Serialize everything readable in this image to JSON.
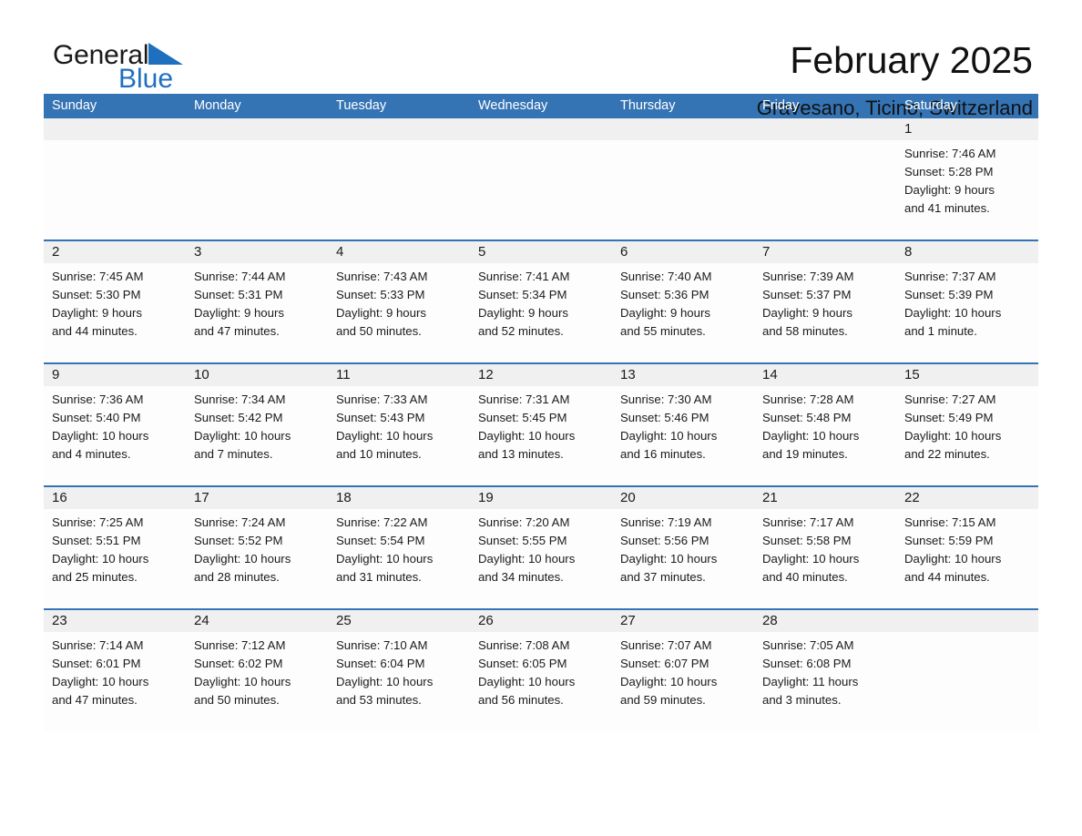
{
  "brand": {
    "name_part1": "General",
    "name_part2": "Blue",
    "logo_icon": "triangle-mark",
    "colors": {
      "text": "#1a1a1a",
      "accent": "#1f6fbf"
    }
  },
  "header": {
    "title": "February 2025",
    "subtitle": "Gravesano, Ticino, Switzerland"
  },
  "theme": {
    "header_blue": "#3574b4",
    "daynum_strip": "#f0f0f0",
    "cell_background": "#fdfdfd",
    "text": "#1a1a1a"
  },
  "weekdays": [
    "Sunday",
    "Monday",
    "Tuesday",
    "Wednesday",
    "Thursday",
    "Friday",
    "Saturday"
  ],
  "weeks": [
    {
      "days": [
        {
          "date": "",
          "sunrise": "",
          "sunset": "",
          "daylight_line1": "",
          "daylight_line2": "",
          "empty": true
        },
        {
          "date": "",
          "sunrise": "",
          "sunset": "",
          "daylight_line1": "",
          "daylight_line2": "",
          "empty": true
        },
        {
          "date": "",
          "sunrise": "",
          "sunset": "",
          "daylight_line1": "",
          "daylight_line2": "",
          "empty": true
        },
        {
          "date": "",
          "sunrise": "",
          "sunset": "",
          "daylight_line1": "",
          "daylight_line2": "",
          "empty": true
        },
        {
          "date": "",
          "sunrise": "",
          "sunset": "",
          "daylight_line1": "",
          "daylight_line2": "",
          "empty": true
        },
        {
          "date": "",
          "sunrise": "",
          "sunset": "",
          "daylight_line1": "",
          "daylight_line2": "",
          "empty": true
        },
        {
          "date": "1",
          "sunrise": "Sunrise: 7:46 AM",
          "sunset": "Sunset: 5:28 PM",
          "daylight_line1": "Daylight: 9 hours",
          "daylight_line2": "and 41 minutes.",
          "empty": false
        }
      ]
    },
    {
      "days": [
        {
          "date": "2",
          "sunrise": "Sunrise: 7:45 AM",
          "sunset": "Sunset: 5:30 PM",
          "daylight_line1": "Daylight: 9 hours",
          "daylight_line2": "and 44 minutes.",
          "empty": false
        },
        {
          "date": "3",
          "sunrise": "Sunrise: 7:44 AM",
          "sunset": "Sunset: 5:31 PM",
          "daylight_line1": "Daylight: 9 hours",
          "daylight_line2": "and 47 minutes.",
          "empty": false
        },
        {
          "date": "4",
          "sunrise": "Sunrise: 7:43 AM",
          "sunset": "Sunset: 5:33 PM",
          "daylight_line1": "Daylight: 9 hours",
          "daylight_line2": "and 50 minutes.",
          "empty": false
        },
        {
          "date": "5",
          "sunrise": "Sunrise: 7:41 AM",
          "sunset": "Sunset: 5:34 PM",
          "daylight_line1": "Daylight: 9 hours",
          "daylight_line2": "and 52 minutes.",
          "empty": false
        },
        {
          "date": "6",
          "sunrise": "Sunrise: 7:40 AM",
          "sunset": "Sunset: 5:36 PM",
          "daylight_line1": "Daylight: 9 hours",
          "daylight_line2": "and 55 minutes.",
          "empty": false
        },
        {
          "date": "7",
          "sunrise": "Sunrise: 7:39 AM",
          "sunset": "Sunset: 5:37 PM",
          "daylight_line1": "Daylight: 9 hours",
          "daylight_line2": "and 58 minutes.",
          "empty": false
        },
        {
          "date": "8",
          "sunrise": "Sunrise: 7:37 AM",
          "sunset": "Sunset: 5:39 PM",
          "daylight_line1": "Daylight: 10 hours",
          "daylight_line2": "and 1 minute.",
          "empty": false
        }
      ]
    },
    {
      "days": [
        {
          "date": "9",
          "sunrise": "Sunrise: 7:36 AM",
          "sunset": "Sunset: 5:40 PM",
          "daylight_line1": "Daylight: 10 hours",
          "daylight_line2": "and 4 minutes.",
          "empty": false
        },
        {
          "date": "10",
          "sunrise": "Sunrise: 7:34 AM",
          "sunset": "Sunset: 5:42 PM",
          "daylight_line1": "Daylight: 10 hours",
          "daylight_line2": "and 7 minutes.",
          "empty": false
        },
        {
          "date": "11",
          "sunrise": "Sunrise: 7:33 AM",
          "sunset": "Sunset: 5:43 PM",
          "daylight_line1": "Daylight: 10 hours",
          "daylight_line2": "and 10 minutes.",
          "empty": false
        },
        {
          "date": "12",
          "sunrise": "Sunrise: 7:31 AM",
          "sunset": "Sunset: 5:45 PM",
          "daylight_line1": "Daylight: 10 hours",
          "daylight_line2": "and 13 minutes.",
          "empty": false
        },
        {
          "date": "13",
          "sunrise": "Sunrise: 7:30 AM",
          "sunset": "Sunset: 5:46 PM",
          "daylight_line1": "Daylight: 10 hours",
          "daylight_line2": "and 16 minutes.",
          "empty": false
        },
        {
          "date": "14",
          "sunrise": "Sunrise: 7:28 AM",
          "sunset": "Sunset: 5:48 PM",
          "daylight_line1": "Daylight: 10 hours",
          "daylight_line2": "and 19 minutes.",
          "empty": false
        },
        {
          "date": "15",
          "sunrise": "Sunrise: 7:27 AM",
          "sunset": "Sunset: 5:49 PM",
          "daylight_line1": "Daylight: 10 hours",
          "daylight_line2": "and 22 minutes.",
          "empty": false
        }
      ]
    },
    {
      "days": [
        {
          "date": "16",
          "sunrise": "Sunrise: 7:25 AM",
          "sunset": "Sunset: 5:51 PM",
          "daylight_line1": "Daylight: 10 hours",
          "daylight_line2": "and 25 minutes.",
          "empty": false
        },
        {
          "date": "17",
          "sunrise": "Sunrise: 7:24 AM",
          "sunset": "Sunset: 5:52 PM",
          "daylight_line1": "Daylight: 10 hours",
          "daylight_line2": "and 28 minutes.",
          "empty": false
        },
        {
          "date": "18",
          "sunrise": "Sunrise: 7:22 AM",
          "sunset": "Sunset: 5:54 PM",
          "daylight_line1": "Daylight: 10 hours",
          "daylight_line2": "and 31 minutes.",
          "empty": false
        },
        {
          "date": "19",
          "sunrise": "Sunrise: 7:20 AM",
          "sunset": "Sunset: 5:55 PM",
          "daylight_line1": "Daylight: 10 hours",
          "daylight_line2": "and 34 minutes.",
          "empty": false
        },
        {
          "date": "20",
          "sunrise": "Sunrise: 7:19 AM",
          "sunset": "Sunset: 5:56 PM",
          "daylight_line1": "Daylight: 10 hours",
          "daylight_line2": "and 37 minutes.",
          "empty": false
        },
        {
          "date": "21",
          "sunrise": "Sunrise: 7:17 AM",
          "sunset": "Sunset: 5:58 PM",
          "daylight_line1": "Daylight: 10 hours",
          "daylight_line2": "and 40 minutes.",
          "empty": false
        },
        {
          "date": "22",
          "sunrise": "Sunrise: 7:15 AM",
          "sunset": "Sunset: 5:59 PM",
          "daylight_line1": "Daylight: 10 hours",
          "daylight_line2": "and 44 minutes.",
          "empty": false
        }
      ]
    },
    {
      "days": [
        {
          "date": "23",
          "sunrise": "Sunrise: 7:14 AM",
          "sunset": "Sunset: 6:01 PM",
          "daylight_line1": "Daylight: 10 hours",
          "daylight_line2": "and 47 minutes.",
          "empty": false
        },
        {
          "date": "24",
          "sunrise": "Sunrise: 7:12 AM",
          "sunset": "Sunset: 6:02 PM",
          "daylight_line1": "Daylight: 10 hours",
          "daylight_line2": "and 50 minutes.",
          "empty": false
        },
        {
          "date": "25",
          "sunrise": "Sunrise: 7:10 AM",
          "sunset": "Sunset: 6:04 PM",
          "daylight_line1": "Daylight: 10 hours",
          "daylight_line2": "and 53 minutes.",
          "empty": false
        },
        {
          "date": "26",
          "sunrise": "Sunrise: 7:08 AM",
          "sunset": "Sunset: 6:05 PM",
          "daylight_line1": "Daylight: 10 hours",
          "daylight_line2": "and 56 minutes.",
          "empty": false
        },
        {
          "date": "27",
          "sunrise": "Sunrise: 7:07 AM",
          "sunset": "Sunset: 6:07 PM",
          "daylight_line1": "Daylight: 10 hours",
          "daylight_line2": "and 59 minutes.",
          "empty": false
        },
        {
          "date": "28",
          "sunrise": "Sunrise: 7:05 AM",
          "sunset": "Sunset: 6:08 PM",
          "daylight_line1": "Daylight: 11 hours",
          "daylight_line2": "and 3 minutes.",
          "empty": false
        },
        {
          "date": "",
          "sunrise": "",
          "sunset": "",
          "daylight_line1": "",
          "daylight_line2": "",
          "empty": true
        }
      ]
    }
  ]
}
